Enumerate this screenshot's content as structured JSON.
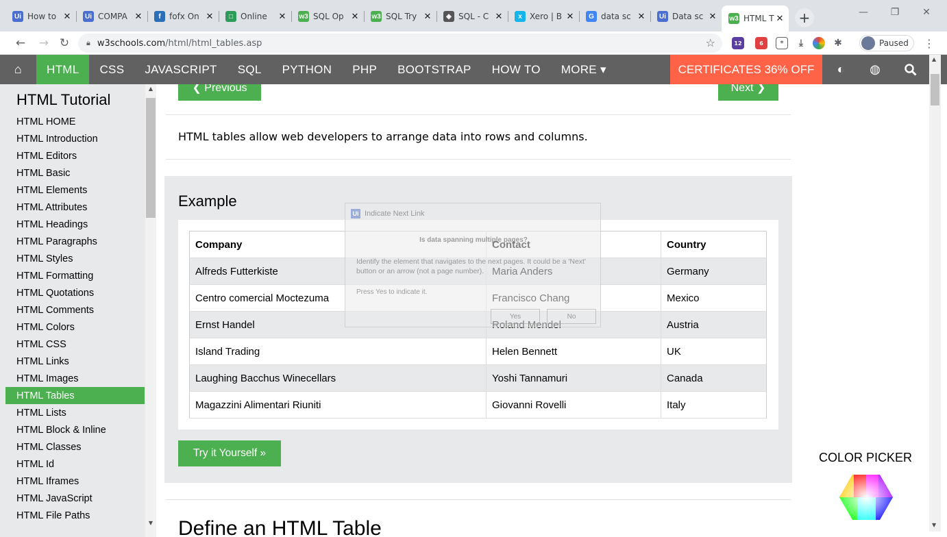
{
  "browser": {
    "tabs": [
      {
        "title": "How to",
        "icon": "uipath-icon",
        "color": "#4a6fd0",
        "glyph": "Ui"
      },
      {
        "title": "COMPA",
        "icon": "uipath-icon",
        "color": "#4a6fd0",
        "glyph": "Ui"
      },
      {
        "title": "fofx On",
        "icon": "chart-icon",
        "color": "#2a6fb8",
        "glyph": "f"
      },
      {
        "title": "Online",
        "icon": "form-icon",
        "color": "#2e9b5a",
        "glyph": "□"
      },
      {
        "title": "SQL Op",
        "icon": "w3schools-icon",
        "color": "#4caf50",
        "glyph": "w3"
      },
      {
        "title": "SQL Try",
        "icon": "w3schools-icon",
        "color": "#4caf50",
        "glyph": "w3"
      },
      {
        "title": "SQL - C",
        "icon": "diamond-icon",
        "color": "#555555",
        "glyph": "◈"
      },
      {
        "title": "Xero | B",
        "icon": "xero-icon",
        "color": "#13b5ea",
        "glyph": "x"
      },
      {
        "title": "data sc",
        "icon": "google-icon",
        "color": "#4285f4",
        "glyph": "G"
      },
      {
        "title": "Data sc",
        "icon": "uipath-icon",
        "color": "#4a6fd0",
        "glyph": "Ui"
      },
      {
        "title": "HTML T",
        "icon": "w3schools-icon",
        "color": "#4caf50",
        "glyph": "w3",
        "active": true
      }
    ],
    "url_domain": "w3schools.com",
    "url_path": "/html/html_tables.asp",
    "profile_label": "Paused",
    "extension_badges": [
      "12",
      "6"
    ]
  },
  "topnav": {
    "items": [
      "HTML",
      "CSS",
      "JAVASCRIPT",
      "SQL",
      "PYTHON",
      "PHP",
      "BOOTSTRAP",
      "HOW TO",
      "MORE ▾"
    ],
    "active": "HTML",
    "cert_label": "CERTIFICATES 36% OFF"
  },
  "sidebar": {
    "title": "HTML Tutorial",
    "links": [
      "HTML HOME",
      "HTML Introduction",
      "HTML Editors",
      "HTML Basic",
      "HTML Elements",
      "HTML Attributes",
      "HTML Headings",
      "HTML Paragraphs",
      "HTML Styles",
      "HTML Formatting",
      "HTML Quotations",
      "HTML Comments",
      "HTML Colors",
      "HTML CSS",
      "HTML Links",
      "HTML Images",
      "HTML Tables",
      "HTML Lists",
      "HTML Block & Inline",
      "HTML Classes",
      "HTML Id",
      "HTML Iframes",
      "HTML JavaScript",
      "HTML File Paths"
    ],
    "active": "HTML Tables"
  },
  "main": {
    "prev_label": "❮ Previous",
    "next_label": "Next ❯",
    "intro": "HTML tables allow web developers to arrange data into rows and columns.",
    "example_title": "Example",
    "table": {
      "headers": [
        "Company",
        "Contact",
        "Country"
      ],
      "rows": [
        [
          "Alfreds Futterkiste",
          "Maria Anders",
          "Germany"
        ],
        [
          "Centro comercial Moctezuma",
          "Francisco Chang",
          "Mexico"
        ],
        [
          "Ernst Handel",
          "Roland Mendel",
          "Austria"
        ],
        [
          "Island Trading",
          "Helen Bennett",
          "UK"
        ],
        [
          "Laughing Bacchus Winecellars",
          "Yoshi Tannamuri",
          "Canada"
        ],
        [
          "Magazzini Alimentari Riuniti",
          "Giovanni Rovelli",
          "Italy"
        ]
      ]
    },
    "try_label": "Try it Yourself »",
    "next_heading": "Define an HTML Table"
  },
  "right": {
    "picker_title": "COLOR PICKER"
  },
  "dialog": {
    "title": "Indicate Next Link",
    "question": "Is data spanning multiple pages?",
    "description": "Identify the element that navigates to the next pages. It could be a 'Next' button or an arrow (not a page number).",
    "press": "Press Yes to indicate it.",
    "yes_label": "Yes",
    "no_label": "No"
  },
  "colors": {
    "w3_green": "#4caf50",
    "topnav_bg": "#616161",
    "cert_bg": "#ff6347",
    "sidebar_bg": "#e7e9eb"
  }
}
